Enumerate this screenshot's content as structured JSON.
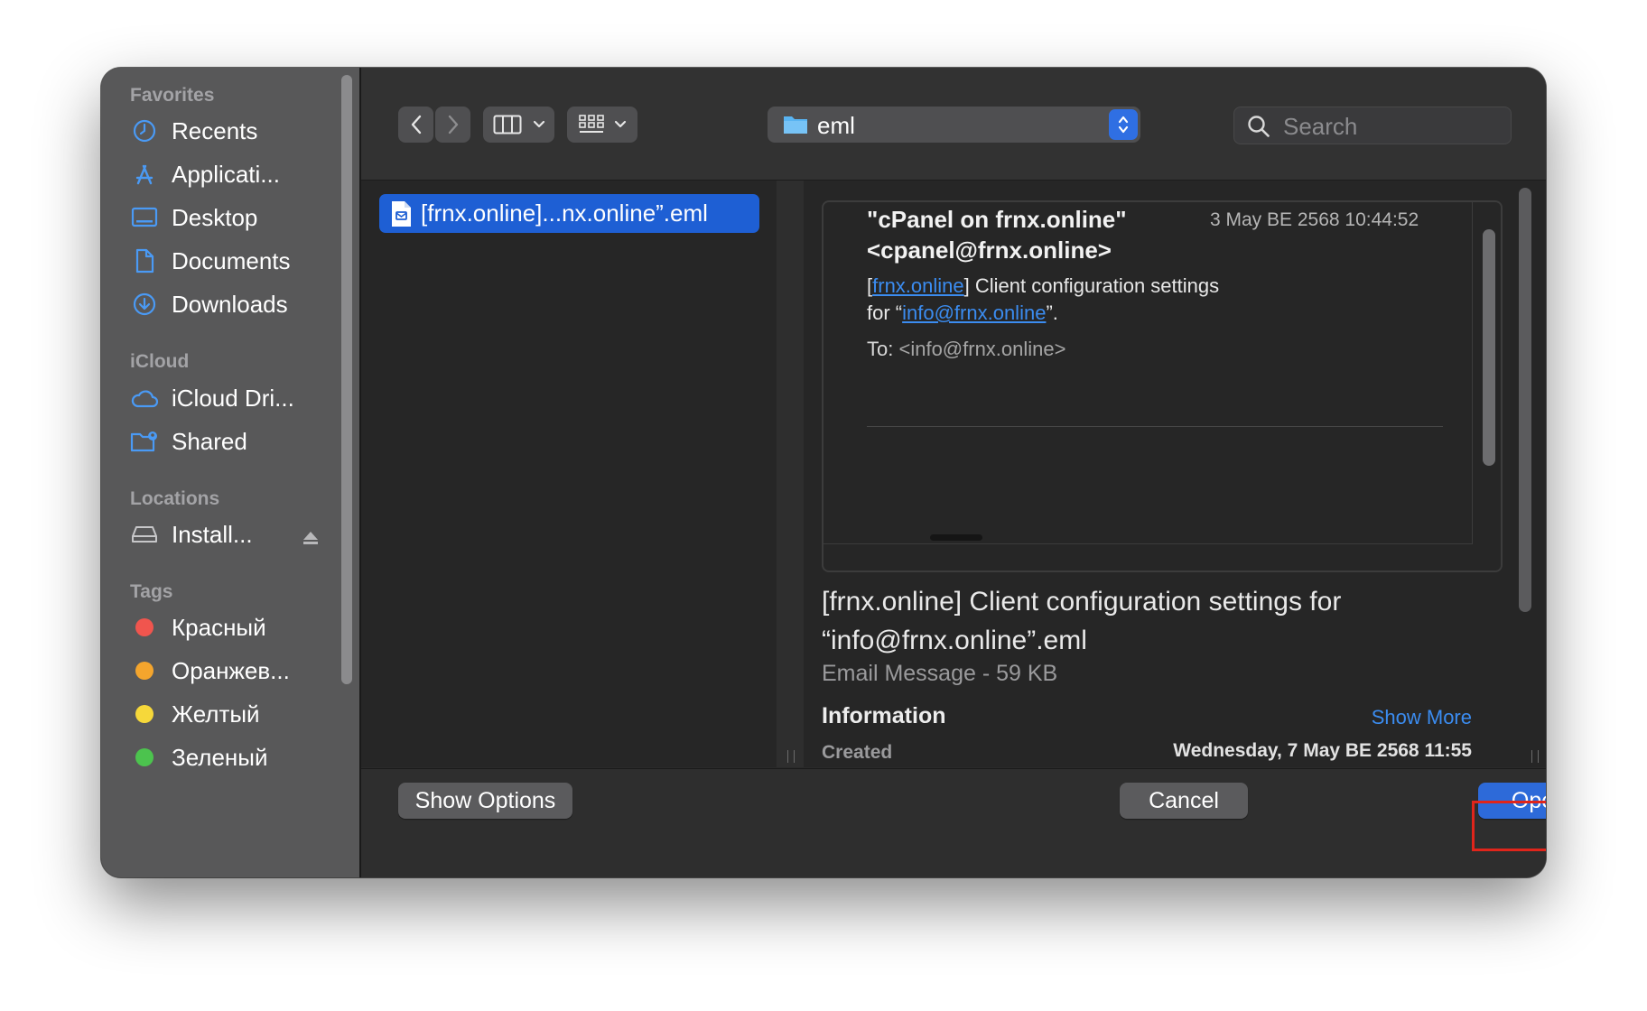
{
  "sidebar": {
    "favorites_title": "Favorites",
    "favorites": [
      {
        "label": "Recents",
        "icon": "clock-icon"
      },
      {
        "label": "Applicati...",
        "icon": "applications-icon"
      },
      {
        "label": "Desktop",
        "icon": "desktop-icon"
      },
      {
        "label": "Documents",
        "icon": "document-icon"
      },
      {
        "label": "Downloads",
        "icon": "download-icon"
      }
    ],
    "icloud_title": "iCloud",
    "icloud": [
      {
        "label": "iCloud Dri...",
        "icon": "cloud-icon"
      },
      {
        "label": "Shared",
        "icon": "shared-folder-icon"
      }
    ],
    "locations_title": "Locations",
    "locations": [
      {
        "label": "Install...",
        "icon": "disk-icon"
      }
    ],
    "tags_title": "Tags",
    "tags": [
      {
        "label": "Красный",
        "color": "#f0554e"
      },
      {
        "label": "Оранжев...",
        "color": "#f4a52d"
      },
      {
        "label": "Желтый",
        "color": "#f6d83a"
      },
      {
        "label": "Зеленый",
        "color": "#4cc34e"
      }
    ]
  },
  "toolbar": {
    "path": "eml",
    "search_placeholder": "Search"
  },
  "files": {
    "selected": "[frnx.online]...nx.online”.eml"
  },
  "preview": {
    "from": "\"cPanel on frnx.online\" <cpanel@frnx.online>",
    "date": "3 May BE 2568 10:44:52",
    "subject_prefix": "[",
    "subject_link": "frnx.online",
    "subject_mid": "] Client configuration settings for “",
    "subject_email": "info@frnx.online",
    "subject_end": "”.",
    "to_label": "To:",
    "to_addr": "<info@frnx.online>",
    "file_name": "[frnx.online] Client configuration settings for “info@frnx.online”.eml",
    "kind": "Email Message - 59 KB",
    "info_title": "Information",
    "show_more": "Show More",
    "created_label": "Created",
    "created_value": "Wednesday, 7 May BE 2568 11:55"
  },
  "buttons": {
    "show_options": "Show Options",
    "cancel": "Cancel",
    "open": "Open"
  },
  "colors": {
    "accent": "#2d6ad9",
    "link": "#3b8cf0",
    "highlight": "#e0251b"
  }
}
